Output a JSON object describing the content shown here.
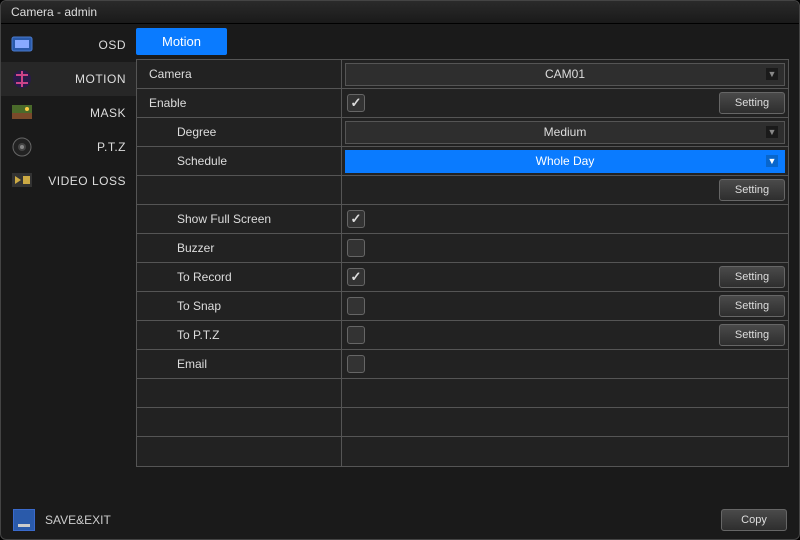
{
  "title": "Camera - admin",
  "sidebar": [
    {
      "label": "OSD",
      "icon": "osd"
    },
    {
      "label": "MOTION",
      "icon": "motion"
    },
    {
      "label": "MASK",
      "icon": "mask"
    },
    {
      "label": "P.T.Z",
      "icon": "ptz"
    },
    {
      "label": "VIDEO LOSS",
      "icon": "videoloss"
    }
  ],
  "tab": "Motion",
  "rows": {
    "camera_label": "Camera",
    "camera_value": "CAM01",
    "enable_label": "Enable",
    "enable_checked": true,
    "degree_label": "Degree",
    "degree_value": "Medium",
    "schedule_label": "Schedule",
    "schedule_value": "Whole Day",
    "showfs_label": "Show Full Screen",
    "showfs_checked": true,
    "buzzer_label": "Buzzer",
    "buzzer_checked": false,
    "record_label": "To Record",
    "record_checked": true,
    "snap_label": "To Snap",
    "snap_checked": false,
    "ptz_label": "To P.T.Z",
    "ptz_checked": false,
    "email_label": "Email",
    "email_checked": false
  },
  "buttons": {
    "setting": "Setting",
    "copy": "Copy",
    "saveexit": "SAVE&EXIT"
  }
}
